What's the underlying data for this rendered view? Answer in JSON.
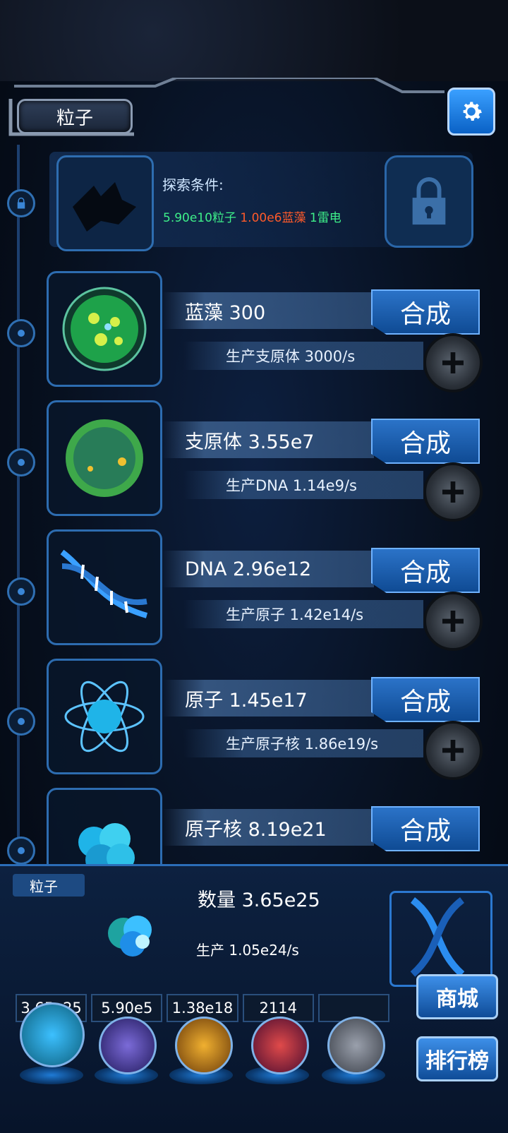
{
  "header": {
    "title": "粒子"
  },
  "locked": {
    "condition_label": "探索条件:",
    "req_1": "5.90e10粒子",
    "req_2": "1.00e6蓝藻",
    "req_3": "1雷电"
  },
  "items": [
    {
      "name": "蓝藻 300",
      "craft": "合成",
      "production": "生产支原体 3000/s"
    },
    {
      "name": "支原体 3.55e7",
      "craft": "合成",
      "production": "生产DNA 1.14e9/s"
    },
    {
      "name": "DNA 2.96e12",
      "craft": "合成",
      "production": "生产原子 1.42e14/s"
    },
    {
      "name": "原子 1.45e17",
      "craft": "合成",
      "production": "生产原子核 1.86e19/s"
    },
    {
      "name": "原子核 8.19e21",
      "craft": "合成",
      "production": ""
    }
  ],
  "bottom": {
    "tag": "粒子",
    "count": "数量 3.65e25",
    "production": "生产 1.05e24/s"
  },
  "resources": [
    "3.65e25",
    "5.90e5",
    "1.38e18",
    "2114",
    ""
  ],
  "side_buttons": {
    "shop": "商城",
    "ranking": "排行榜"
  },
  "colors": {
    "accent": "#2b73c8",
    "req_green": "#3ef08a",
    "req_orange": "#ff5a2a"
  }
}
